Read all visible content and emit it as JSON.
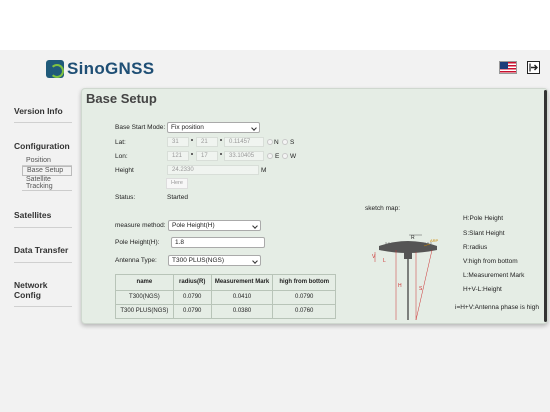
{
  "brand": {
    "name": "SinoGNSS"
  },
  "header": {
    "flag_icon": "us-flag-icon",
    "exit_icon": "logout-icon"
  },
  "sidebar": {
    "version_info": "Version Info",
    "configuration": "Configuration",
    "sub": [
      "Position",
      "Base Setup",
      "Satellite Tracking"
    ],
    "satellites": "Satellites",
    "data_transfer": "Data Transfer",
    "network_config": "Network Config"
  },
  "page": {
    "title": "Base Setup",
    "base_start_mode_label": "Base Start Mode:",
    "base_start_mode_value": "Fix position",
    "lat_label": "Lat:",
    "lat_deg": "31",
    "lat_min": "21",
    "lat_sec": "0.11457",
    "lat_n": "N",
    "lat_s": "S",
    "lon_label": "Lon:",
    "lon_deg": "121",
    "lon_min": "17",
    "lon_sec": "33.10405",
    "lon_e": "E",
    "lon_w": "W",
    "height_label": "Height",
    "height_value": "24.2330",
    "height_unit": "M",
    "here_button": "Here",
    "status_label": "Status:",
    "status_value": "Started",
    "measure_method_label": "measure method:",
    "measure_method_value": "Pole Height(H)",
    "pole_height_label": "Pole Height(H):",
    "pole_height_value": "1.8",
    "antenna_type_label": "Antenna Type:",
    "antenna_type_value": "T300 PLUS(NGS)",
    "table": {
      "headers": [
        "name",
        "radius(R)",
        "Measurement Mark",
        "high from bottom"
      ],
      "rows": [
        [
          "T300(NGS)",
          "0.0790",
          "0.0410",
          "0.0790"
        ],
        [
          "T300 PLUS(NGS)",
          "0.0790",
          "0.0380",
          "0.0760"
        ]
      ]
    },
    "sketch_map_label": "sketch map:",
    "sketch_labels": {
      "r": "R",
      "h": "H",
      "s": "S",
      "v": "V",
      "l": "L",
      "arp": "ARP"
    },
    "legend": [
      "H:Pole Height",
      "S:Slant Height",
      "R:radius",
      "V:high from bottom",
      "L:Measurement Mark",
      "H+V-L:Height",
      "i=H+V:Antenna phase is high"
    ]
  }
}
